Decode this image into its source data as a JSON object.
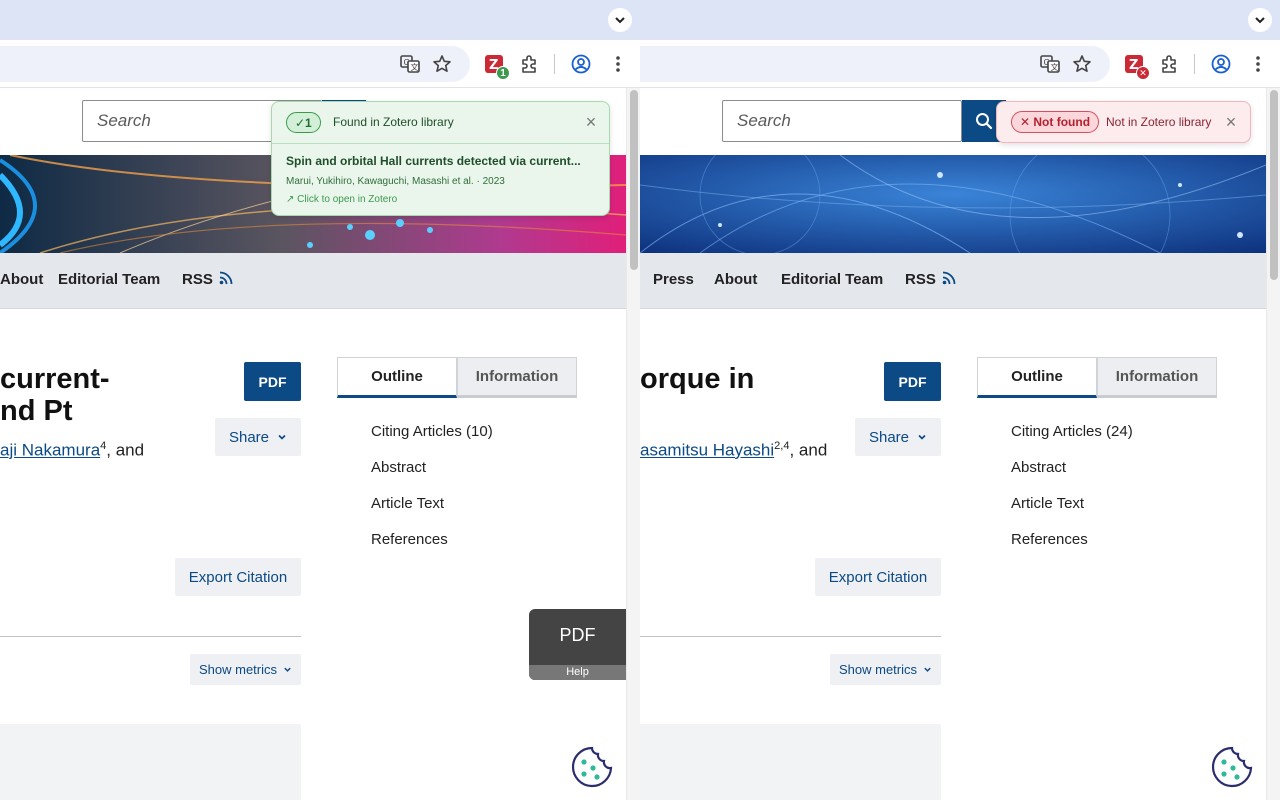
{
  "left": {
    "search_placeholder": "Search",
    "nav": [
      "About",
      "Editorial Team",
      "RSS"
    ],
    "title_line1": "current-",
    "title_line2": "nd Pt",
    "author_link": "aji Nakamura",
    "author_sup": "4",
    "author_suffix": ", and",
    "pdf_label": "PDF",
    "share_label": "Share",
    "export_label": "Export Citation",
    "metrics_label": "Show metrics",
    "tabs": {
      "outline": "Outline",
      "information": "Information"
    },
    "outline_links": [
      "Citing Articles (10)",
      "Abstract",
      "Article Text",
      "References"
    ],
    "pdf_help": {
      "big": "PDF",
      "small": "Help"
    },
    "zotero_badge": "1",
    "popup": {
      "pill": "✓1",
      "status": "Found in Zotero library",
      "item_title": "Spin and orbital Hall currents detected via current...",
      "item_meta": "Marui, Yukihiro, Kawaguchi, Masashi et al. · 2023",
      "open_link": "↗ Click to open in Zotero"
    }
  },
  "right": {
    "search_placeholder": "Search",
    "nav": [
      "Press",
      "About",
      "Editorial Team",
      "RSS"
    ],
    "title_line1": "orque in",
    "author_link": "asamitsu Hayashi",
    "author_sup": "2,4",
    "author_suffix": ", and",
    "pdf_label": "PDF",
    "share_label": "Share",
    "export_label": "Export Citation",
    "metrics_label": "Show metrics",
    "tabs": {
      "outline": "Outline",
      "information": "Information"
    },
    "outline_links": [
      "Citing Articles (24)",
      "Abstract",
      "Article Text",
      "References"
    ],
    "popup": {
      "pill": "✕ Not found",
      "status": "Not in Zotero library"
    }
  },
  "colors": {
    "brand_blue": "#0b4a84",
    "found_green": "#3c9a4e",
    "notfound_red": "#d6505d",
    "tabstrip": "#dde4f5"
  }
}
